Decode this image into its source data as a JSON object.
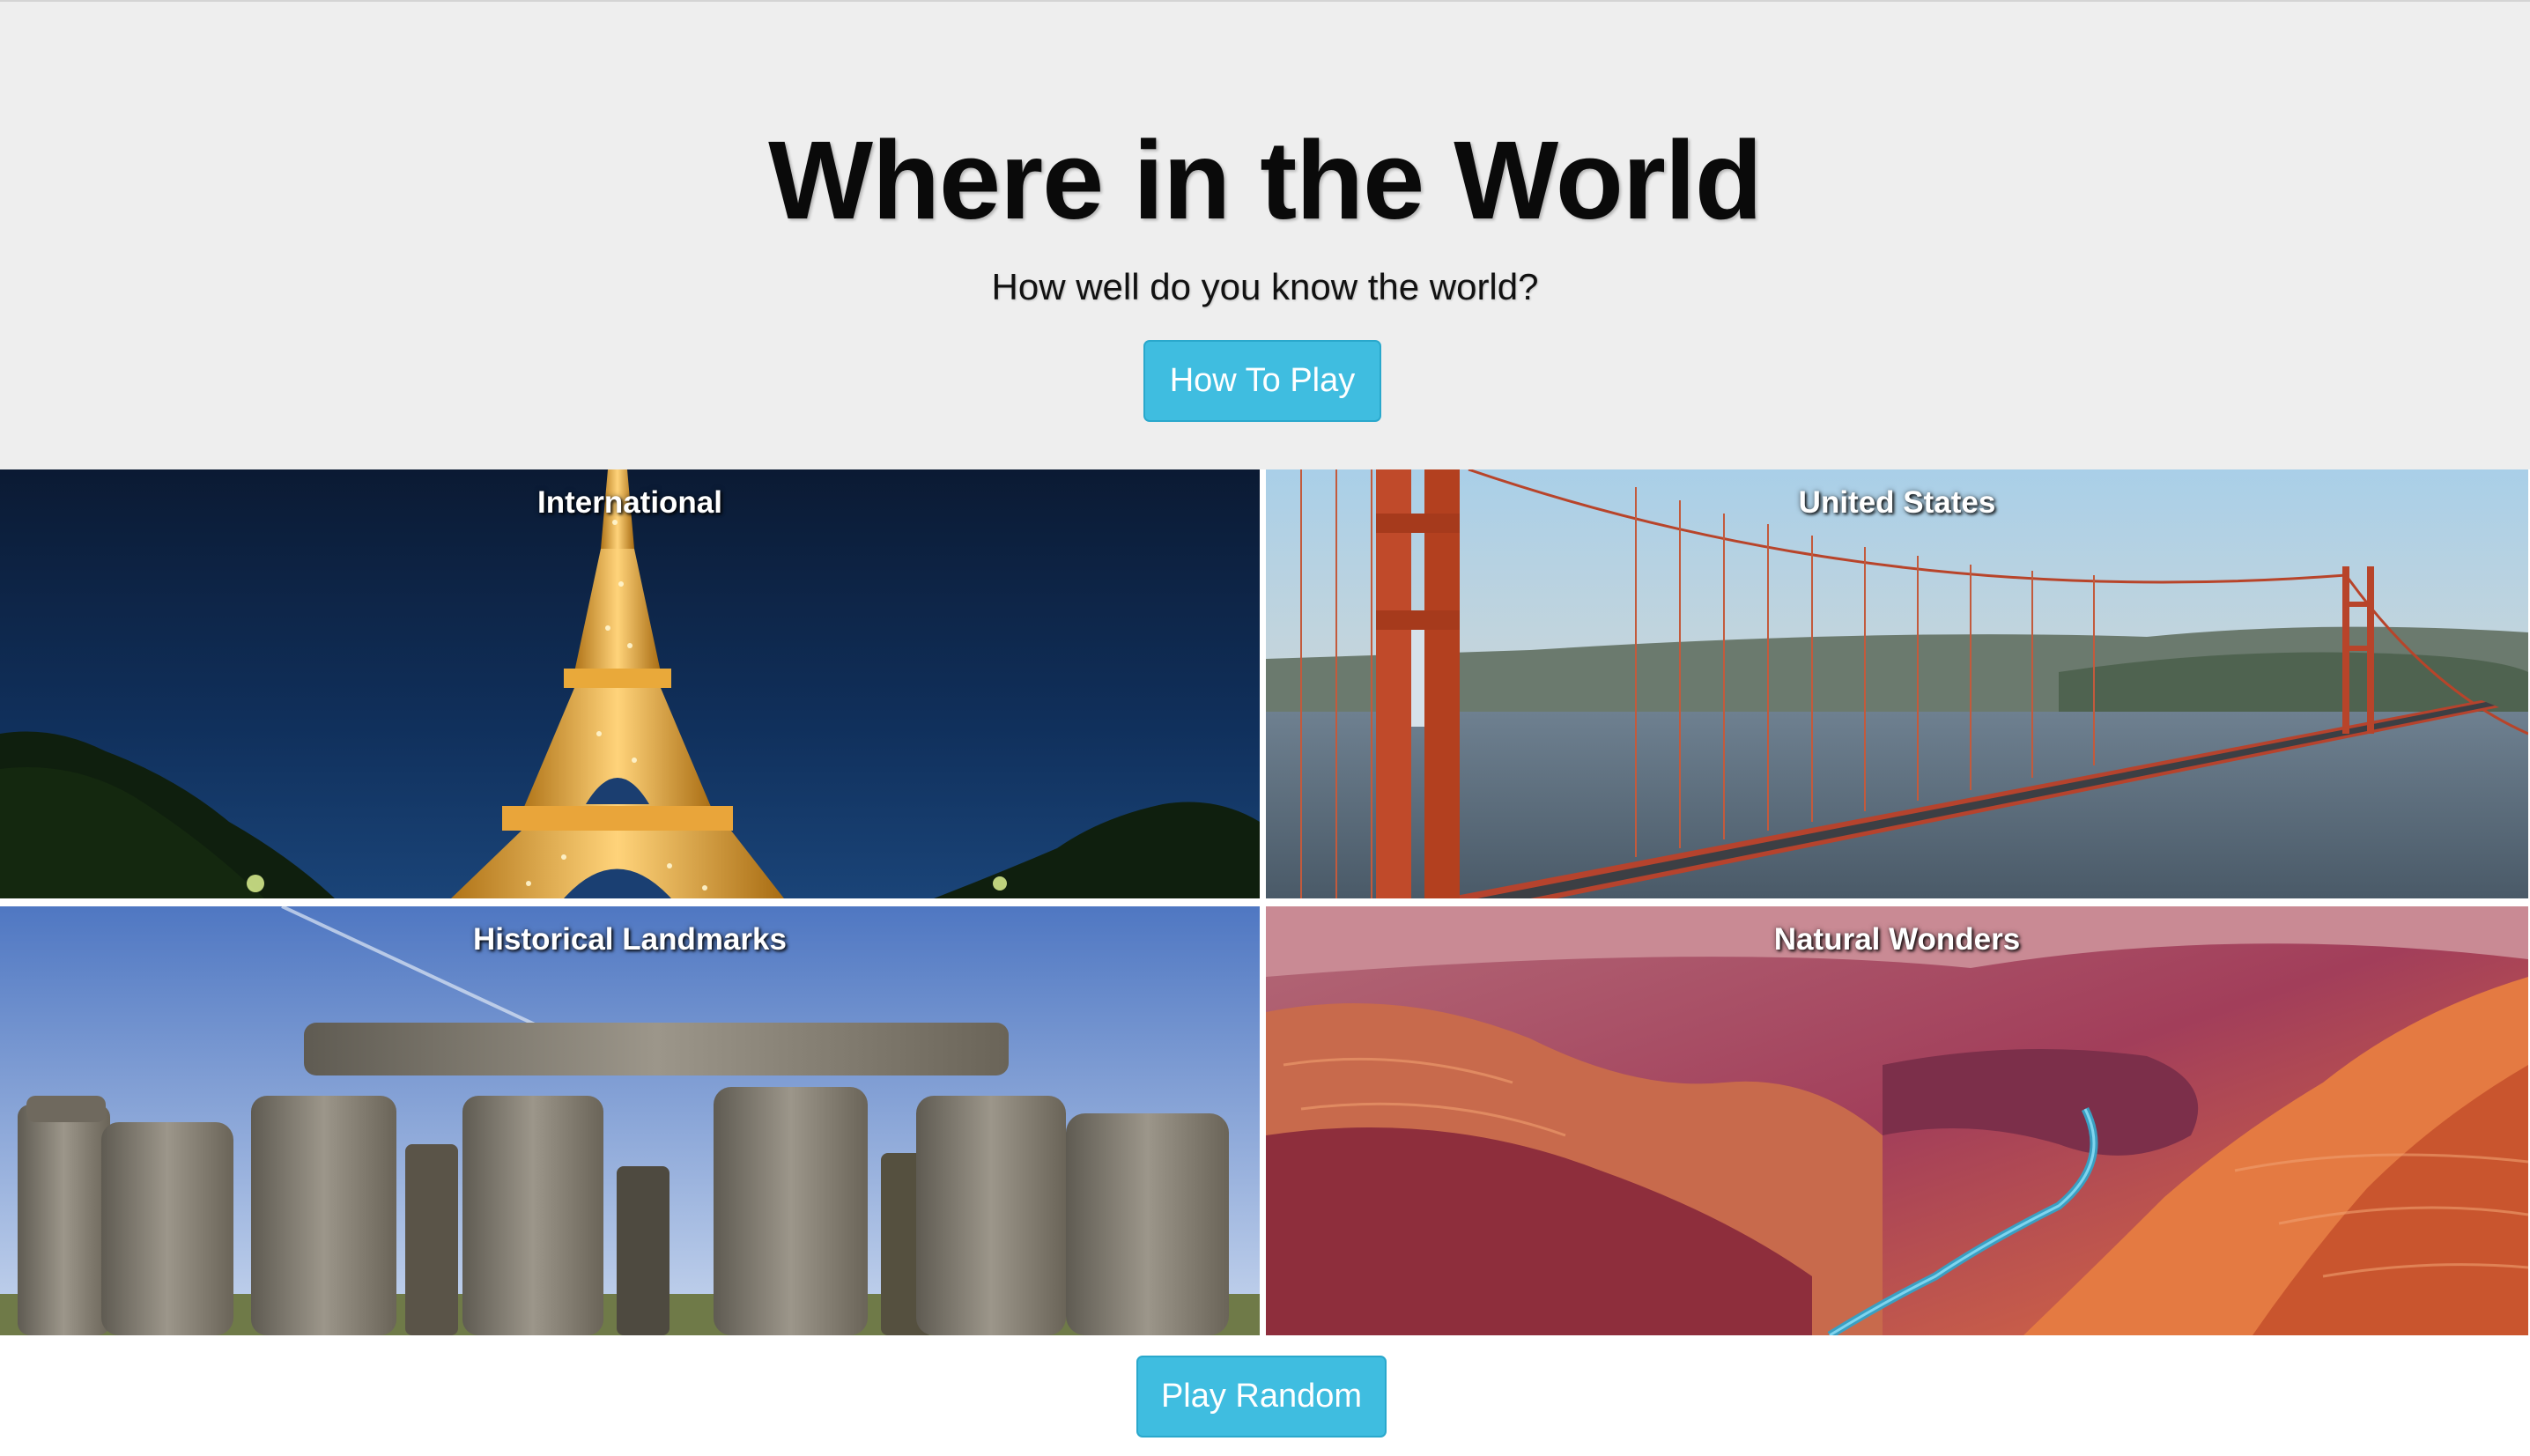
{
  "header": {
    "title": "Where in the World",
    "subtitle": "How well do you know the world?",
    "how_to_play_label": "How To Play"
  },
  "categories": [
    {
      "label": "International"
    },
    {
      "label": "United States"
    },
    {
      "label": "Historical Landmarks"
    },
    {
      "label": "Natural Wonders"
    }
  ],
  "footer": {
    "play_random_label": "Play Random"
  },
  "colors": {
    "hero_background": "#eeeeee",
    "button": "#3fbde0",
    "button_text": "#ffffff"
  }
}
